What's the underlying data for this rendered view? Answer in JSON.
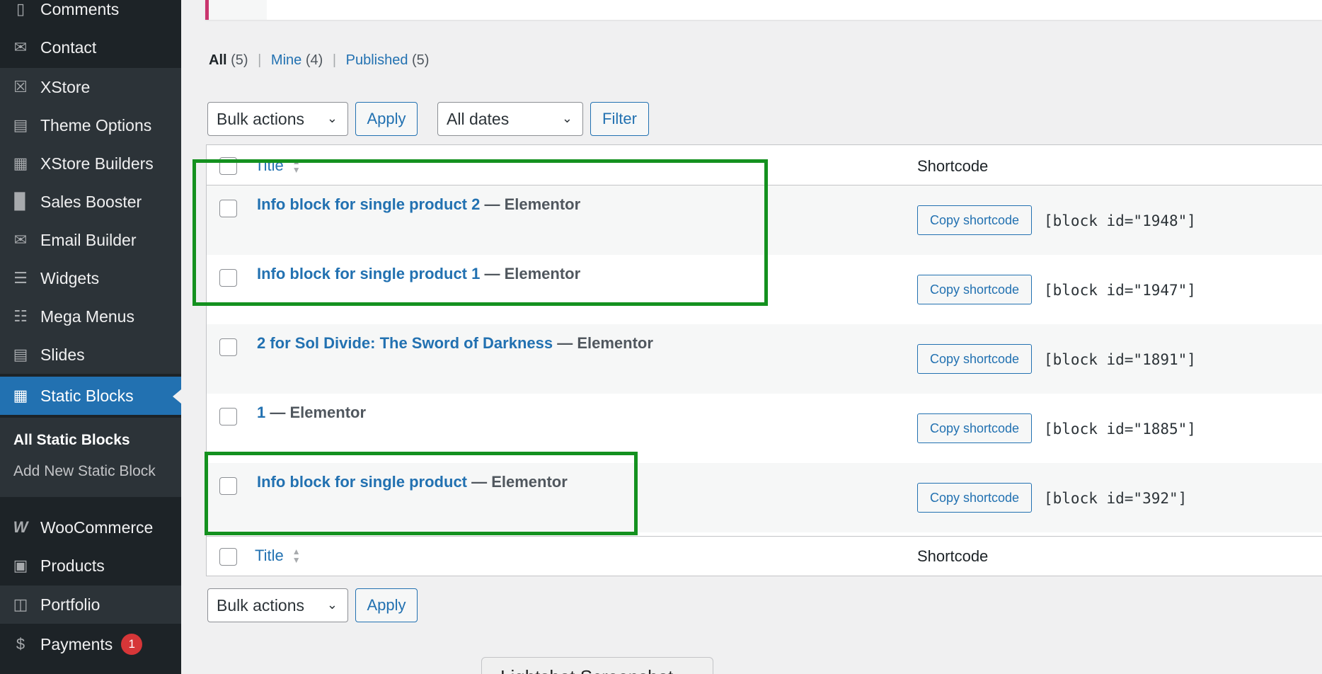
{
  "sidebar": {
    "items": [
      {
        "label": "Comments",
        "icon": "comment-icon"
      },
      {
        "label": "Contact",
        "icon": "mail-icon"
      },
      {
        "label": "XStore",
        "icon": "xstore-icon"
      },
      {
        "label": "Theme Options",
        "icon": "sliders-icon"
      },
      {
        "label": "XStore Builders",
        "icon": "builder-grid-icon"
      },
      {
        "label": "Sales Booster",
        "icon": "bar-chart-icon"
      },
      {
        "label": "Email Builder",
        "icon": "envelope-icon"
      },
      {
        "label": "Widgets",
        "icon": "widgets-icon"
      },
      {
        "label": "Mega Menus",
        "icon": "mega-menu-icon"
      },
      {
        "label": "Slides",
        "icon": "slides-icon"
      },
      {
        "label": "Static Blocks",
        "icon": "static-blocks-icon"
      },
      {
        "label": "WooCommerce",
        "icon": "woocommerce-icon"
      },
      {
        "label": "Products",
        "icon": "archive-icon"
      },
      {
        "label": "Portfolio",
        "icon": "portfolio-icon"
      },
      {
        "label": "Payments",
        "icon": "dollar-icon",
        "badge": "1"
      }
    ],
    "submenu": {
      "all": "All Static Blocks",
      "add_new": "Add New Static Block"
    }
  },
  "views": {
    "all_label": "All",
    "all_count": "(5)",
    "mine_label": "Mine",
    "mine_count": "(4)",
    "published_label": "Published",
    "published_count": "(5)",
    "separator": "|"
  },
  "toolbar": {
    "bulk_actions": "Bulk actions",
    "apply": "Apply",
    "all_dates": "All dates",
    "filter": "Filter"
  },
  "table": {
    "col_title": "Title",
    "col_shortcode": "Shortcode",
    "copy_label": "Copy shortcode",
    "rows": [
      {
        "title": "Info block for single product 2",
        "suffix": " — Elementor",
        "shortcode": "[block id=\"1948\"]"
      },
      {
        "title": "Info block for single product 1",
        "suffix": " — Elementor",
        "shortcode": "[block id=\"1947\"]"
      },
      {
        "title": "2 for Sol Divide: The Sword of Darkness",
        "suffix": " — Elementor",
        "shortcode": "[block id=\"1891\"]"
      },
      {
        "title": "1",
        "suffix": " — Elementor",
        "shortcode": "[block id=\"1885\"]"
      },
      {
        "title": "Info block for single product",
        "suffix": " — Elementor",
        "shortcode": "[block id=\"392\"]"
      }
    ]
  },
  "bottom_toolbar": {
    "bulk_actions": "Bulk actions",
    "apply": "Apply"
  },
  "lightshot": "Lightshot Screenshot",
  "colors": {
    "sidebar_bg": "#1d2327",
    "active_bg": "#2271b1",
    "link": "#2271b1",
    "highlight": "#14911f",
    "badge": "#d63638"
  }
}
